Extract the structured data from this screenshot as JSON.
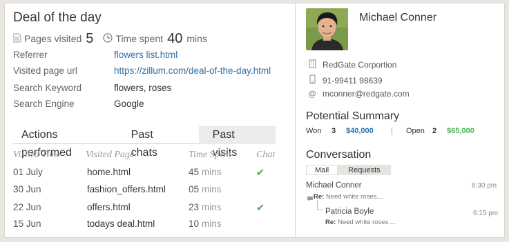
{
  "deal": {
    "title": "Deal of the day",
    "pages_visited_label": "Pages visited",
    "pages_visited_value": "5",
    "time_spent_label": "Time spent",
    "time_spent_value": "40",
    "time_spent_unit": "mins",
    "fields": [
      {
        "label": "Referrer",
        "value": "flowers list.html",
        "link": true
      },
      {
        "label": "Visited page url",
        "value": "https://zillum.com/deal-of-the-day.html",
        "link": true
      },
      {
        "label": "Search Keyword",
        "value": "flowers, roses",
        "link": false
      },
      {
        "label": "Search Engine",
        "value": "Google",
        "link": false
      }
    ]
  },
  "tabs": {
    "actions": "Actions performed",
    "chats": "Past chats",
    "visits": "Past visits"
  },
  "visits_table": {
    "headers": {
      "time": "Visited Time",
      "page": "Visited Page",
      "spent": "Time Spent",
      "chat": "Chat"
    },
    "rows": [
      {
        "time": "01 July",
        "page": "home.html",
        "spent": "45",
        "unit": "mins",
        "chat": true
      },
      {
        "time": "30 Jun",
        "page": "fashion_offers.html",
        "spent": "05",
        "unit": "mins",
        "chat": false
      },
      {
        "time": "22 Jun",
        "page": "offers.html",
        "spent": "23",
        "unit": "mins",
        "chat": true
      },
      {
        "time": "15 Jun",
        "page": "todays deal.html",
        "spent": "10",
        "unit": "mins",
        "chat": false
      }
    ]
  },
  "contact": {
    "name": "Michael Conner",
    "company": "RedGate Corportion",
    "phone": "91-99411 98639",
    "email": "mconner@redgate.com"
  },
  "summary": {
    "title": "Potential Summary",
    "won_label": "Won",
    "won_count": "3",
    "won_amount": "$40,000",
    "separator": "|",
    "open_label": "Open",
    "open_count": "2",
    "open_amount": "$65,000"
  },
  "conversation": {
    "title": "Conversation",
    "tab_mail": "Mail",
    "tab_requests": "Requests",
    "messages": [
      {
        "sender": "Michael Conner",
        "time": "8:30 pm",
        "re_label": "Re:",
        "subject": "Need white roses...."
      },
      {
        "sender": "Patricia Boyle",
        "time": "6:15 pm",
        "re_label": "Re:",
        "subject": "Need white roses...."
      }
    ]
  },
  "colors": {
    "link": "#2f6fa7",
    "won_amount": "#2f6fa7",
    "open_amount": "#4caf50",
    "check": "#5cb85c"
  },
  "icons": {
    "pages": "document-icon",
    "time": "clock-icon",
    "company": "building-icon",
    "phone": "mobile-phone-icon",
    "email": "at-icon",
    "chat": "check-icon",
    "reply": "chat-bubble-icon"
  }
}
